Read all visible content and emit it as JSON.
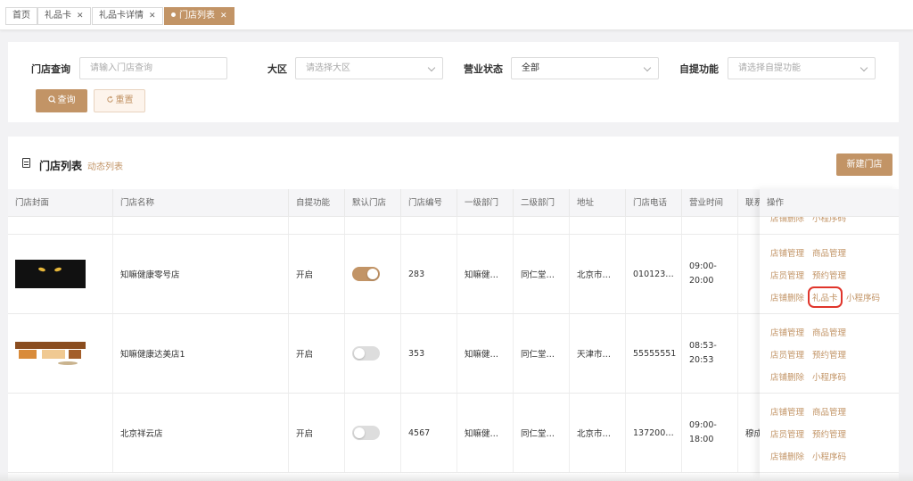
{
  "tabs": [
    {
      "label": "首页",
      "closable": false,
      "active": false
    },
    {
      "label": "礼品卡",
      "closable": true,
      "active": false
    },
    {
      "label": "礼品卡详情",
      "closable": true,
      "active": false
    },
    {
      "label": "门店列表",
      "closable": true,
      "active": true
    }
  ],
  "tab_close_glyph": "✕",
  "filter": {
    "store_query_label": "门店查询",
    "store_query_placeholder": "请输入门店查询",
    "region_label": "大区",
    "region_placeholder": "请选择大区",
    "status_label": "营业状态",
    "status_value": "全部",
    "pickup_label": "自提功能",
    "pickup_placeholder": "请选择自提功能",
    "query_button": "查询",
    "reset_button": "重置"
  },
  "list": {
    "title": "门店列表",
    "subtitle": "动态列表",
    "new_button": "新建门店",
    "columns": [
      "门店封面",
      "门店名称",
      "自提功能",
      "默认门店",
      "门店编号",
      "一级部门",
      "二级部门",
      "地址",
      "门店电话",
      "营业时间",
      "联系"
    ],
    "ops_header": "操作",
    "rows": [
      {
        "cover": "black-cat-photo",
        "name": "知嘛健康零号店",
        "pickup": "开启",
        "default_on": true,
        "code": "283",
        "dept1": "知嘛健…",
        "dept2": "同仁堂…",
        "address": "北京市…",
        "phone": "010123…",
        "hours": "09:00-20:00",
        "contact": ""
      },
      {
        "cover": "store-interior-photo",
        "name": "知嘛健康达美店1",
        "pickup": "开启",
        "default_on": false,
        "code": "353",
        "dept1": "知嘛健…",
        "dept2": "同仁堂…",
        "address": "天津市…",
        "phone": "55555551",
        "hours": "08:53-20:53",
        "contact": ""
      },
      {
        "cover": "",
        "name": "北京祥云店",
        "pickup": "开启",
        "default_on": false,
        "code": "4567",
        "dept1": "知嘛健…",
        "dept2": "同仁堂…",
        "address": "北京市…",
        "phone": "137200…",
        "hours": "09:00-18:00",
        "contact": "穆成"
      }
    ],
    "partial_top_ops": [
      "店铺删除",
      "小程序码"
    ],
    "row_ops": [
      {
        "store_manage": "店铺管理",
        "goods_manage": "商品管理",
        "staff_manage": "店员管理",
        "booking_manage": "预约管理",
        "store_delete": "店铺删除",
        "gift_card": "礼品卡",
        "mini_program_code": "小程序码"
      },
      {
        "store_manage": "店铺管理",
        "goods_manage": "商品管理",
        "staff_manage": "店员管理",
        "booking_manage": "预约管理",
        "store_delete": "店铺删除",
        "mini_program_code": "小程序码"
      },
      {
        "store_manage": "店铺管理",
        "goods_manage": "商品管理",
        "staff_manage": "店员管理",
        "booking_manage": "预约管理",
        "store_delete": "店铺删除",
        "mini_program_code": "小程序码"
      }
    ]
  },
  "colors": {
    "accent": "#c29466",
    "highlight": "#e0352b"
  },
  "icons": {
    "search": "search-icon",
    "reset": "refresh-icon",
    "list": "document-icon"
  }
}
